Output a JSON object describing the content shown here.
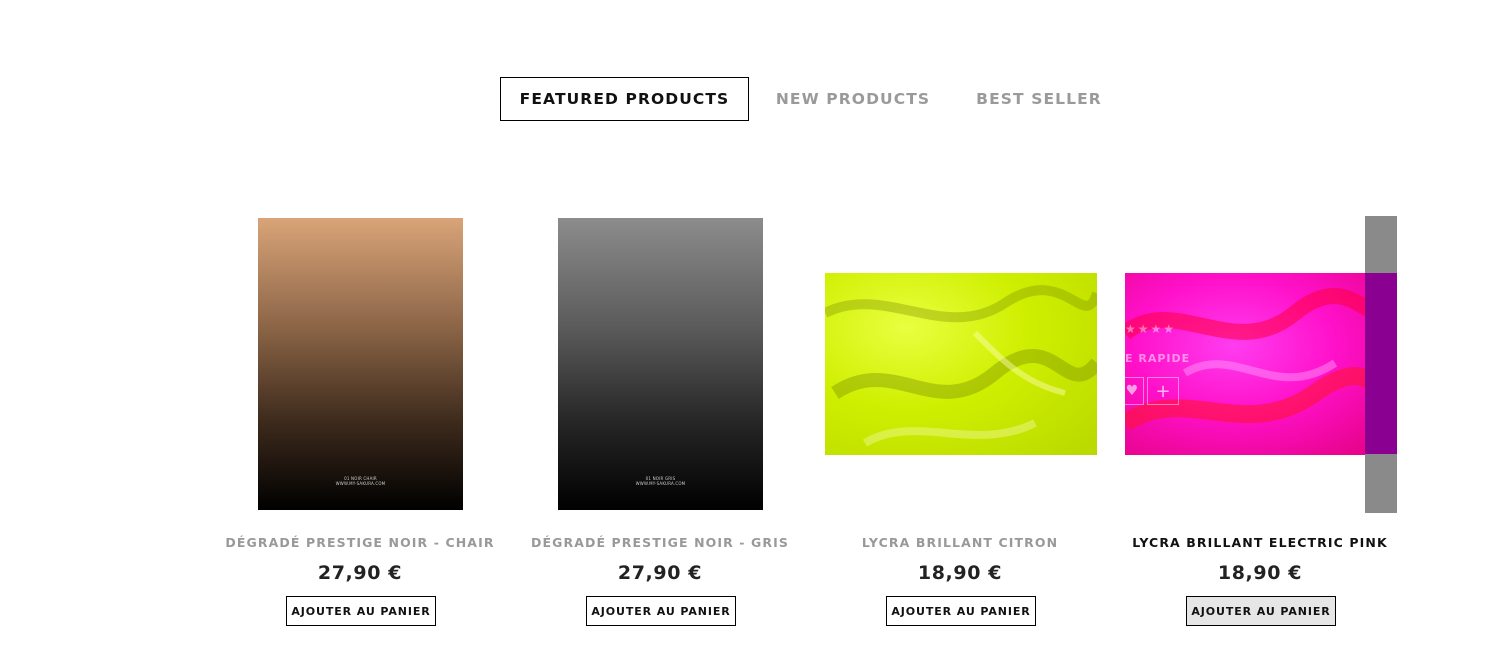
{
  "tabs": [
    {
      "label": "FEATURED PRODUCTS",
      "active": true
    },
    {
      "label": "NEW PRODUCTS",
      "active": false
    },
    {
      "label": "BEST SELLER",
      "active": false
    }
  ],
  "products": [
    {
      "title": "DÉGRADÉ PRESTIGE NOIR - CHAIR",
      "price": "27,90 €",
      "button": "AJOUTER AU PANIER",
      "poster_line1": "01 NOIR CHAIR",
      "poster_line2": "WWW.MY-SAKURA.COM"
    },
    {
      "title": "DÉGRADÉ PRESTIGE NOIR - GRIS",
      "price": "27,90 €",
      "button": "AJOUTER AU PANIER",
      "poster_line1": "01 NOIR GRIS",
      "poster_line2": "WWW.MY-SAKURA.COM"
    },
    {
      "title": "LYCRA BRILLANT CITRON",
      "price": "18,90 €",
      "button": "AJOUTER AU PANIER"
    },
    {
      "title": "LYCRA BRILLANT ELECTRIC PINK",
      "price": "18,90 €",
      "button": "AJOUTER AU PANIER",
      "overlay": {
        "stars": "★★★★",
        "quick_view": "E RAPIDE",
        "heart_icon": "heart-icon",
        "plus_icon": "plus-icon"
      }
    }
  ],
  "colors": {
    "active_tab_border": "#000000",
    "inactive_tab_text": "#9a9a9a",
    "title_muted": "#999999",
    "price_text": "#222222"
  }
}
